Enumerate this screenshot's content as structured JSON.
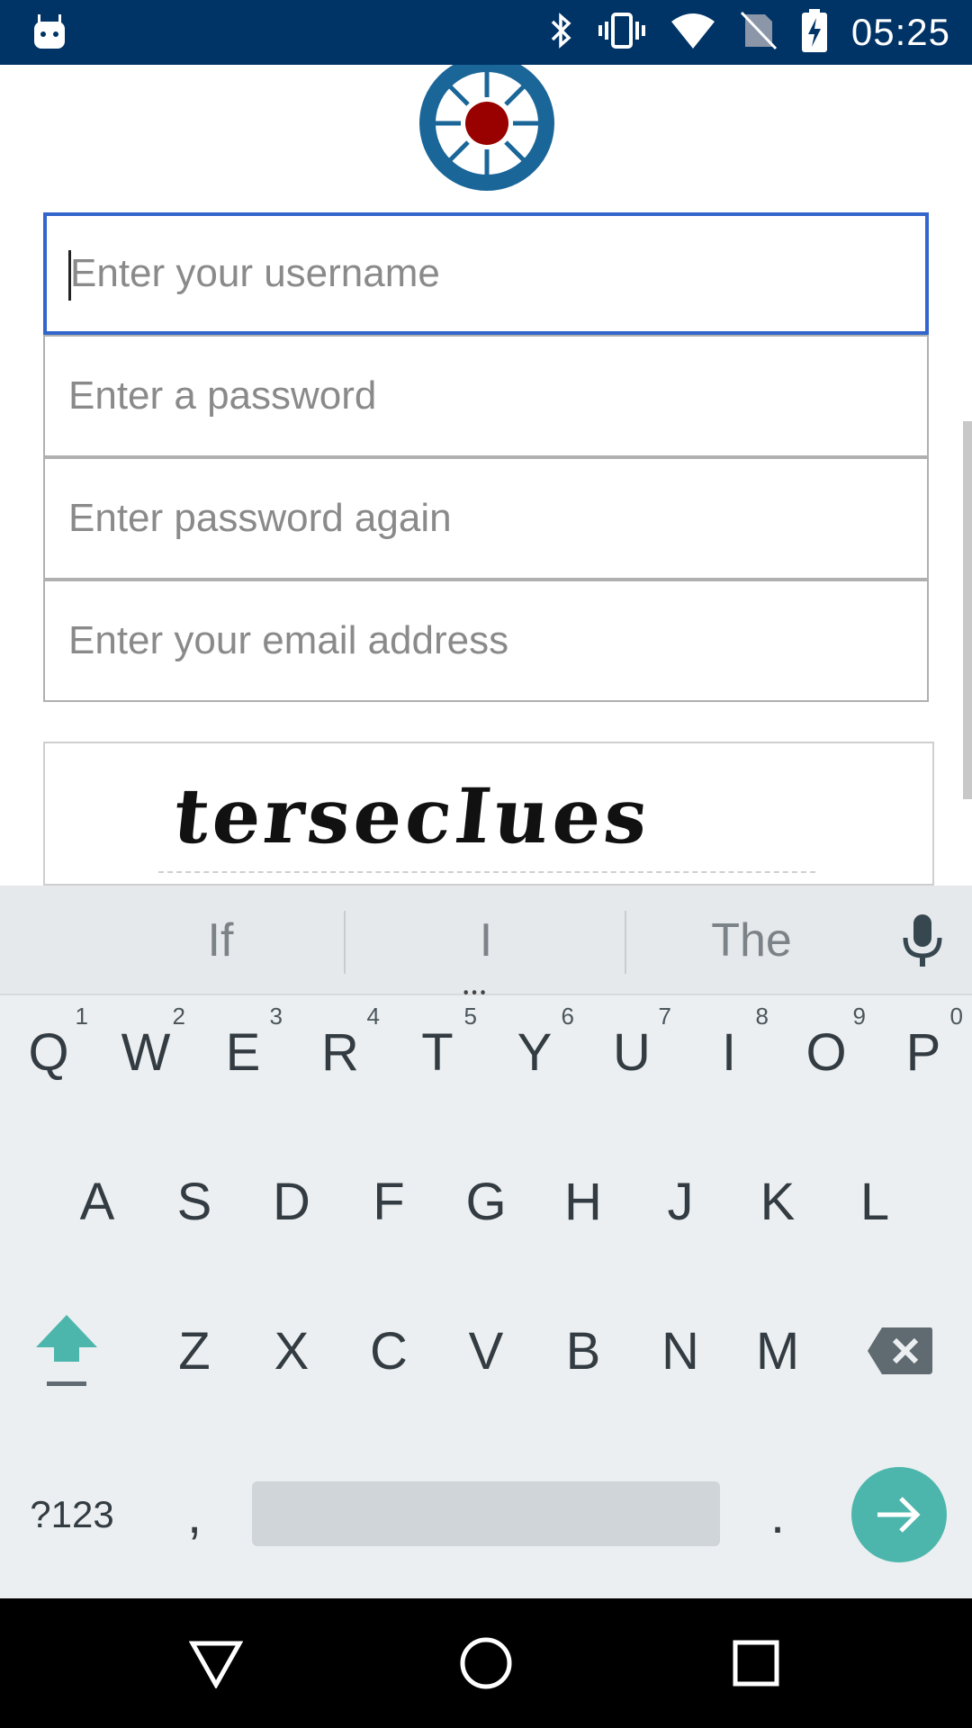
{
  "status_bar": {
    "time": "05:25",
    "icons": [
      "android-icon",
      "bluetooth-icon",
      "vibrate-icon",
      "wifi-icon",
      "no-sim-icon",
      "battery-charging-icon"
    ]
  },
  "form": {
    "username_placeholder": "Enter your username",
    "password_placeholder": "Enter a password",
    "password_again_placeholder": "Enter password again",
    "email_placeholder": "Enter your email address",
    "captcha_text": "tersecIues"
  },
  "keyboard": {
    "suggestions": [
      "If",
      "I",
      "The"
    ],
    "row1": [
      {
        "key": "Q",
        "hint": "1"
      },
      {
        "key": "W",
        "hint": "2"
      },
      {
        "key": "E",
        "hint": "3"
      },
      {
        "key": "R",
        "hint": "4"
      },
      {
        "key": "T",
        "hint": "5"
      },
      {
        "key": "Y",
        "hint": "6"
      },
      {
        "key": "U",
        "hint": "7"
      },
      {
        "key": "I",
        "hint": "8"
      },
      {
        "key": "O",
        "hint": "9"
      },
      {
        "key": "P",
        "hint": "0"
      }
    ],
    "row2": [
      "A",
      "S",
      "D",
      "F",
      "G",
      "H",
      "J",
      "K",
      "L"
    ],
    "row3": [
      "Z",
      "X",
      "C",
      "V",
      "B",
      "N",
      "M"
    ],
    "symbols_label": "?123",
    "comma": ",",
    "period": "."
  },
  "colors": {
    "status_bar": "#003366",
    "focus_border": "#3366cc",
    "keyboard_bg": "#eceff1",
    "enter_key": "#4db6ac"
  }
}
